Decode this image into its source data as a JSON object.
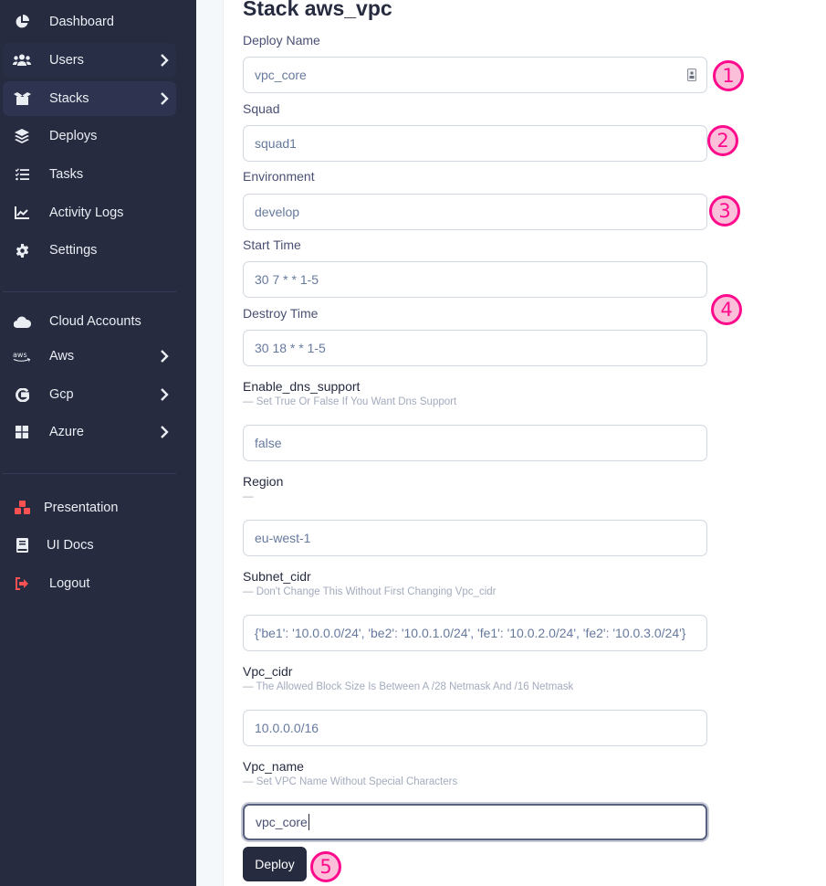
{
  "sidebar": {
    "items": [
      {
        "label": "Dashboard",
        "icon": "chart-pie-icon"
      },
      {
        "label": "Users",
        "icon": "users-icon",
        "has_submenu": true
      },
      {
        "label": "Stacks",
        "icon": "box-open-icon",
        "has_submenu": true,
        "active": true
      },
      {
        "label": "Deploys",
        "icon": "layer-group-icon"
      },
      {
        "label": "Tasks",
        "icon": "tasks-icon"
      },
      {
        "label": "Activity Logs",
        "icon": "chart-line-icon"
      },
      {
        "label": "Settings",
        "icon": "cog-icon"
      },
      {
        "label": "Cloud Accounts",
        "icon": "cloud-icon"
      },
      {
        "label": "Aws",
        "icon": "aws-icon",
        "has_submenu": true
      },
      {
        "label": "Gcp",
        "icon": "google-icon",
        "has_submenu": true
      },
      {
        "label": "Azure",
        "icon": "windows-icon",
        "has_submenu": true
      },
      {
        "label": "Presentation",
        "icon": "cubes-icon"
      },
      {
        "label": "UI Docs",
        "icon": "book-icon"
      },
      {
        "label": "Logout",
        "icon": "sign-out-icon"
      }
    ]
  },
  "colors": {
    "sidebar_bg": "#262b40",
    "accent_red": "#fa5252",
    "badge_border": "#ff0a8c",
    "badge_fill": "#fbbfd9"
  },
  "form": {
    "title": "Stack aws_vpc",
    "fields": [
      {
        "label": "Deploy Name",
        "value": "vpc_core"
      },
      {
        "label": "Squad",
        "value": "squad1"
      },
      {
        "label": "Environment",
        "value": "develop"
      },
      {
        "label": "Start Time",
        "value": "30 7 * * 1-5"
      },
      {
        "label": "Destroy Time",
        "value": "30 18 * * 1-5"
      },
      {
        "label": "Enable_dns_support",
        "hint": "— Set True Or False If You Want Dns Support",
        "value": "false"
      },
      {
        "label": "Region",
        "hint": "—",
        "value": "eu-west-1"
      },
      {
        "label": "Subnet_cidr",
        "hint": "— Don't Change This Without First Changing Vpc_cidr",
        "value": "{'be1': '10.0.0.0/24', 'be2': '10.0.1.0/24', 'fe1': '10.0.2.0/24', 'fe2': '10.0.3.0/24'}"
      },
      {
        "label": "Vpc_cidr",
        "hint": "— The Allowed Block Size Is Between A /28 Netmask And /16 Netmask",
        "value": "10.0.0.0/16"
      },
      {
        "label": "Vpc_name",
        "hint": "— Set VPC Name Without Special Characters",
        "value": "vpc_core"
      }
    ],
    "deploy_label": "Deploy"
  },
  "annotations": [
    "1",
    "2",
    "3",
    "4",
    "5"
  ]
}
